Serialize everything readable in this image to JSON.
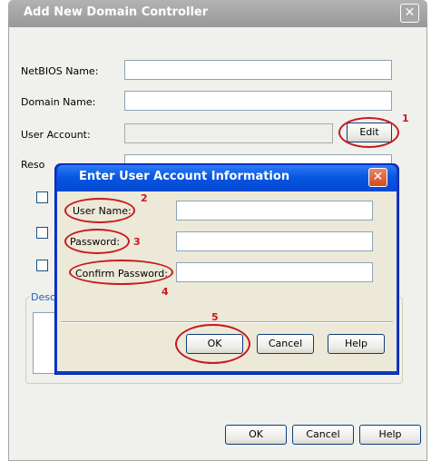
{
  "main_window": {
    "title": "Add New Domain Controller",
    "close_glyph": "✕",
    "fields": {
      "netbios_label": "NetBIOS Name:",
      "netbios_value": "",
      "domain_label": "Domain Name:",
      "domain_value": "",
      "user_account_label": "User Account:",
      "user_account_value": "",
      "resource_label_partial": "Reso"
    },
    "edit_button": "Edit",
    "description_legend_partial": "Desc",
    "buttons": {
      "ok": "OK",
      "cancel": "Cancel",
      "help": "Help"
    }
  },
  "dialog": {
    "title": "Enter User Account Information",
    "close_glyph": "✕",
    "fields": {
      "user_name_label": "User Name:",
      "user_name_value": "",
      "password_label": "Password:",
      "password_value": "",
      "confirm_password_label": "Confirm Password:",
      "confirm_password_value": ""
    },
    "buttons": {
      "ok": "OK",
      "cancel": "Cancel",
      "help": "Help"
    }
  },
  "annotations": {
    "n1": "1",
    "n2": "2",
    "n3": "3",
    "n4": "4",
    "n5": "5"
  },
  "colors": {
    "annotation_red": "#c8191e",
    "dialog_titlebar_blue": "#0757e2",
    "main_titlebar_gray": "#a4a4a4"
  }
}
